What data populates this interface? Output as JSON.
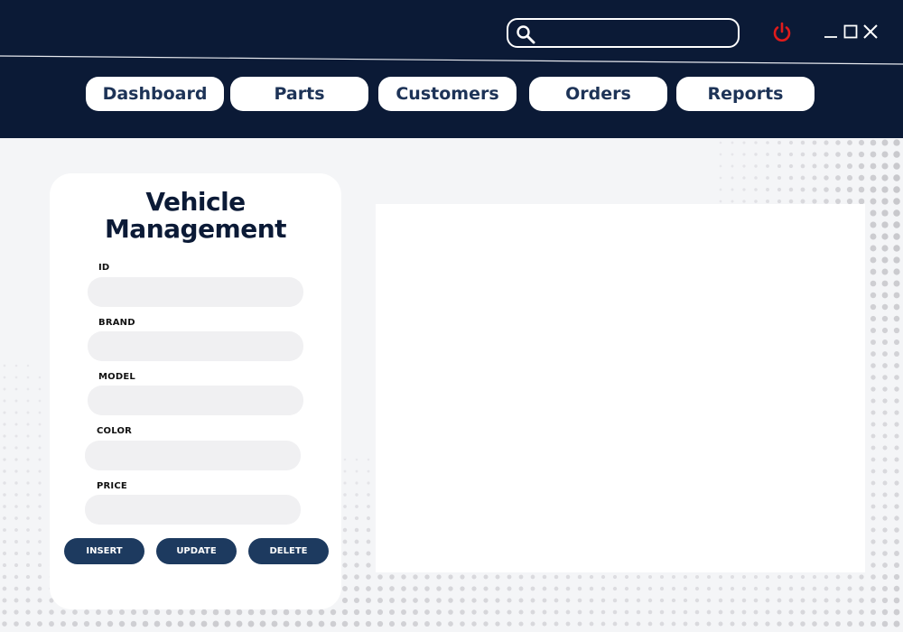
{
  "colors": {
    "header_bg": "#0b1a36",
    "nav_text": "#1d3357",
    "button_bg": "#1d3a5f",
    "power_icon": "#e01b1b",
    "input_bg": "#f0f0f2"
  },
  "window": {
    "search": {
      "value": "",
      "placeholder": ""
    },
    "controls": [
      "power-icon",
      "minimize-icon",
      "maximize-icon",
      "close-icon"
    ]
  },
  "nav": {
    "items": [
      {
        "label": "Dashboard"
      },
      {
        "label": "Parts"
      },
      {
        "label": "Customers"
      },
      {
        "label": "Orders"
      },
      {
        "label": "Reports"
      }
    ]
  },
  "form": {
    "title_line1": "Vehicle",
    "title_line2": "Management",
    "fields": [
      {
        "label": "ID",
        "value": ""
      },
      {
        "label": "BRAND",
        "value": ""
      },
      {
        "label": "MODEL",
        "value": ""
      },
      {
        "label": "COLOR",
        "value": ""
      },
      {
        "label": "PRICE",
        "value": ""
      }
    ],
    "buttons": [
      {
        "label": "INSERT"
      },
      {
        "label": "UPDATE"
      },
      {
        "label": "DELETE"
      }
    ]
  }
}
